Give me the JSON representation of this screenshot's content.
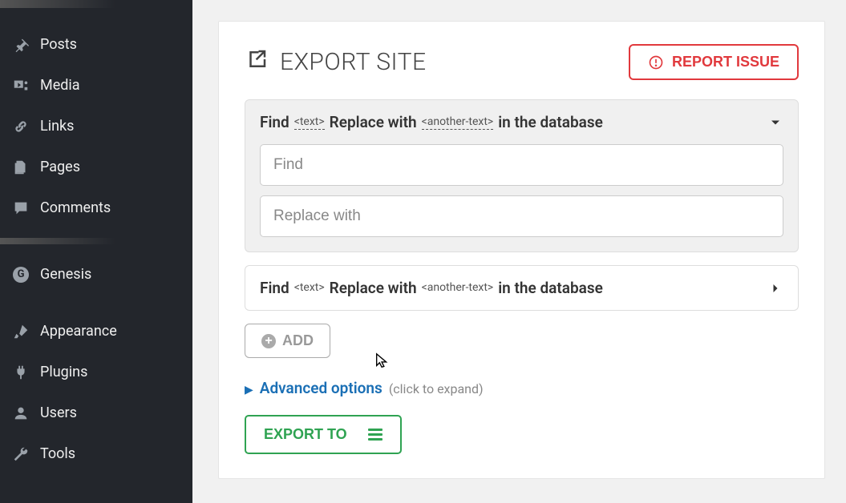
{
  "sidebar": {
    "items": [
      {
        "label": "Posts",
        "icon": "pin"
      },
      {
        "label": "Media",
        "icon": "media"
      },
      {
        "label": "Links",
        "icon": "link"
      },
      {
        "label": "Pages",
        "icon": "pages"
      },
      {
        "label": "Comments",
        "icon": "comment"
      }
    ],
    "items2": [
      {
        "label": "Genesis",
        "icon": "genesis"
      },
      {
        "label": "Appearance",
        "icon": "brush"
      },
      {
        "label": "Plugins",
        "icon": "plug"
      },
      {
        "label": "Users",
        "icon": "user"
      },
      {
        "label": "Tools",
        "icon": "wrench"
      }
    ]
  },
  "page": {
    "title": "EXPORT SITE",
    "report_label": "REPORT ISSUE"
  },
  "panel": {
    "find_label": "Find",
    "text_token": "<text>",
    "replace_label": "Replace with",
    "another_token": "<another-text>",
    "suffix": "in the database",
    "find_placeholder": "Find",
    "replace_placeholder": "Replace with"
  },
  "actions": {
    "add_label": "ADD",
    "advanced_label": "Advanced options",
    "advanced_hint": "(click to expand)",
    "export_label": "EXPORT TO"
  }
}
